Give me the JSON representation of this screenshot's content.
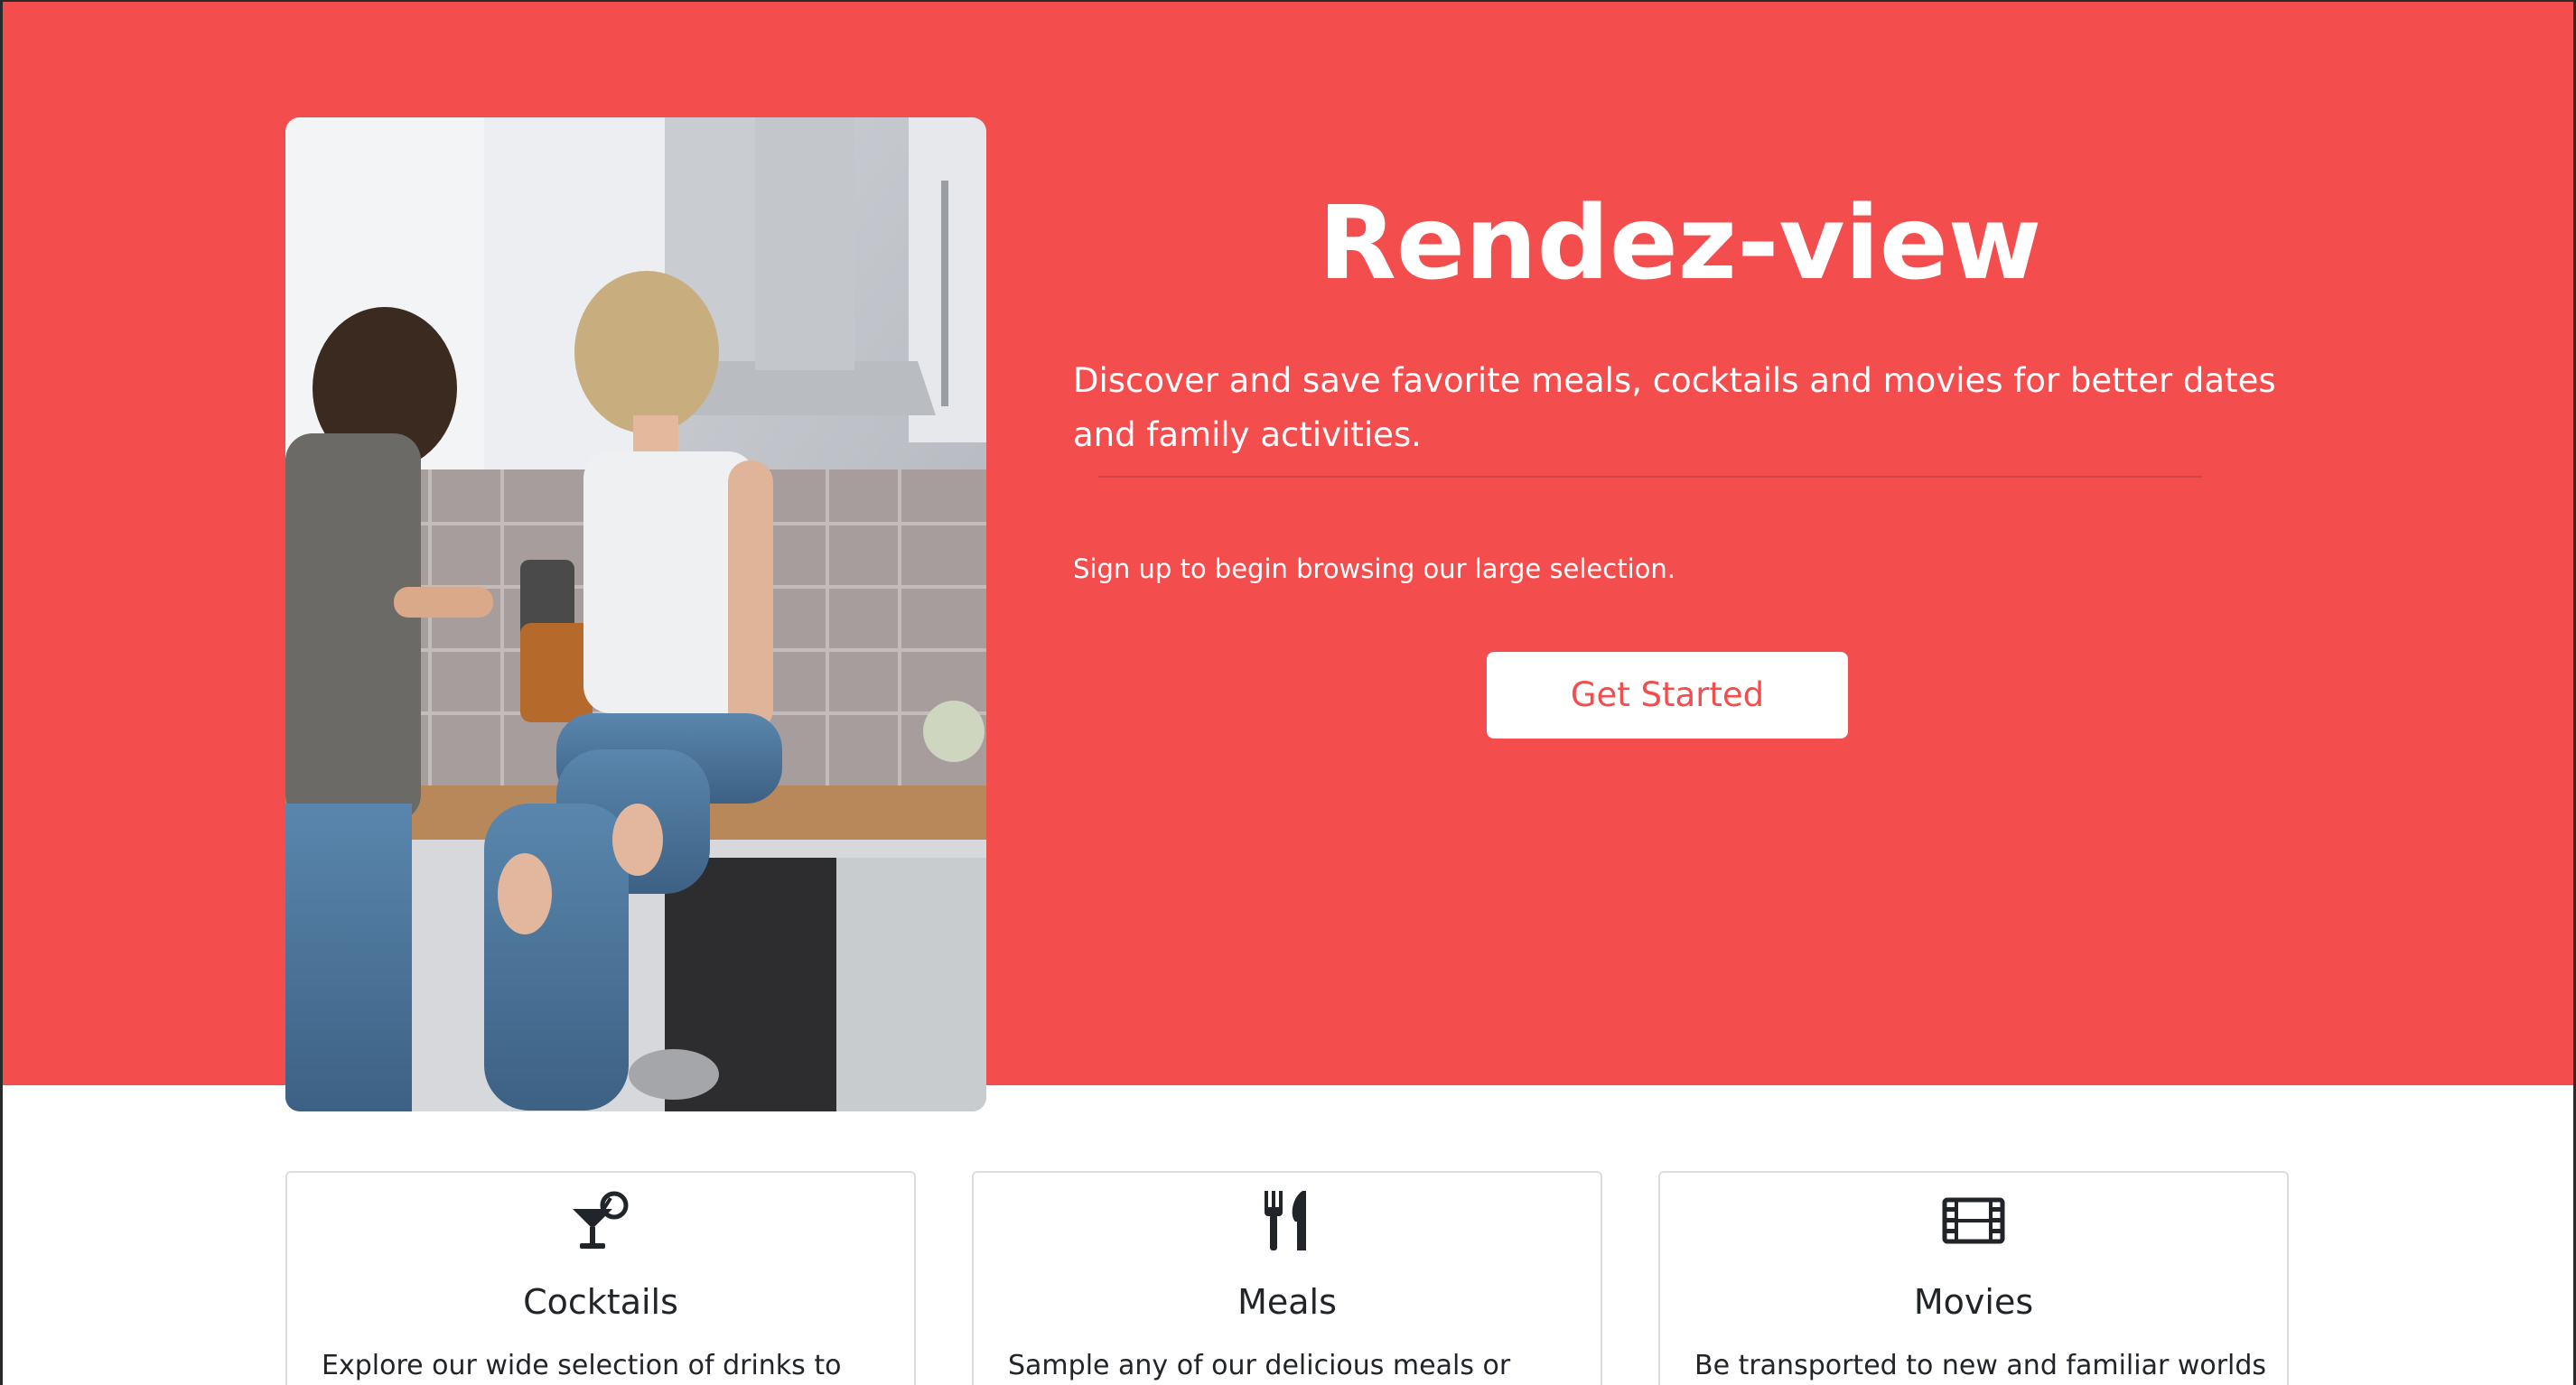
{
  "colors": {
    "brand": "#f44d4e",
    "card_border": "#dcdcdc",
    "text_dark": "#212529"
  },
  "hero": {
    "title": "Rendez-view",
    "description": "Discover and save favorite meals, cocktails and movies for better dates and family activities.",
    "signup_text": "Sign up to begin browsing our large selection.",
    "cta_label": "Get Started",
    "image_subject": "couple-in-kitchen-photo"
  },
  "features": [
    {
      "icon": "cocktail-icon",
      "title": "Cocktails",
      "text": "Explore our wide selection of drinks to"
    },
    {
      "icon": "utensils-icon",
      "title": "Meals",
      "text": "Sample any of our delicious meals or"
    },
    {
      "icon": "film-icon",
      "title": "Movies",
      "text": "Be transported to new and familiar worlds"
    }
  ]
}
